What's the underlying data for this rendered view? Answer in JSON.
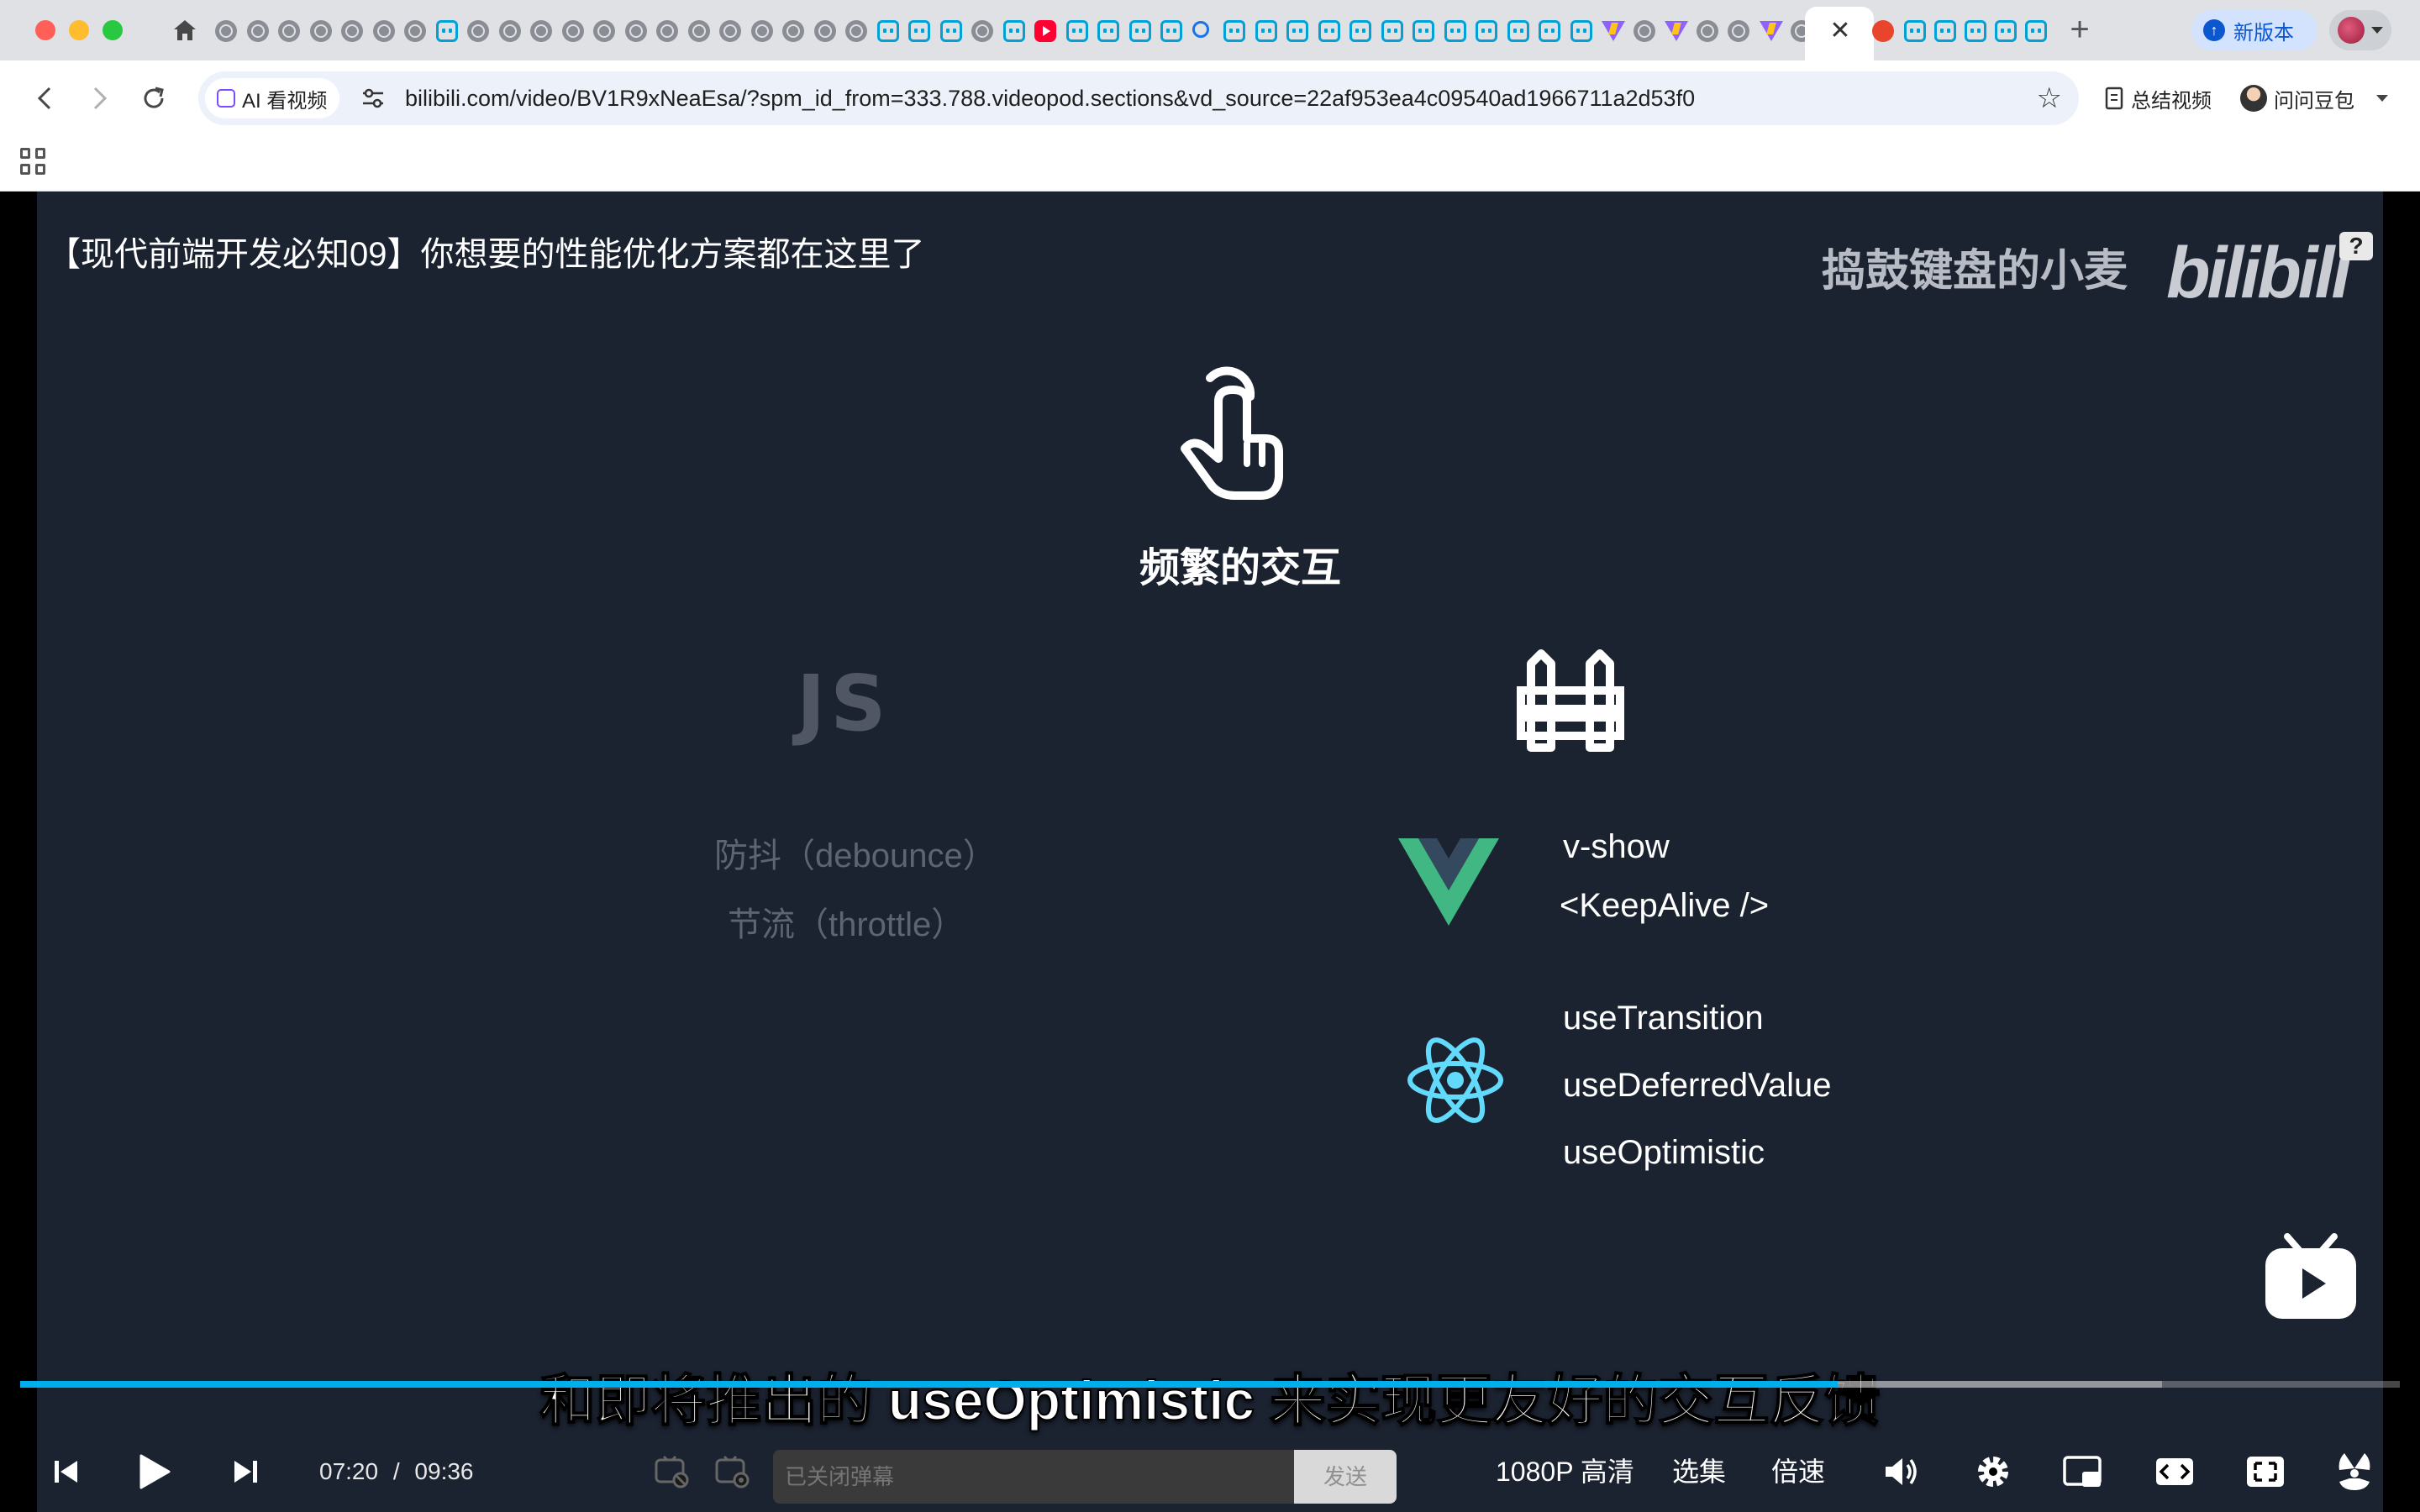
{
  "browser": {
    "new_tab_symbol": "+",
    "close_tab_symbol": "✕",
    "update_label": "新版本",
    "url": "bilibili.com/video/BV1R9xNeaEsa/?spm_id_from=333.788.videopod.sections&vd_source=22af953ea4c09540ad1966711a2d53f0",
    "ai_chip_label": "AI 看视频",
    "summary_label": "总结视频",
    "doubao_label": "问问豆包"
  },
  "video": {
    "title": "【现代前端开发必知09】你想要的性能优化方案都在这里了",
    "watermark": "捣鼓键盘的小麦",
    "logo_text": "bilibili",
    "help_badge": "?",
    "center_label": "频繁的交互",
    "js_logo_text": "JS",
    "js_items": [
      "防抖（debounce）",
      "节流（throttle）"
    ],
    "vue_items": [
      "v-show",
      "<KeepAlive />"
    ],
    "react_items": [
      "useTransition",
      "useDeferredValue",
      "useOptimistic"
    ],
    "subtitle": "和即将推出的 useOptimistic 来实现更友好的交互反馈"
  },
  "player": {
    "progress_fraction": 0.7639,
    "buffered_fraction": 0.9,
    "current_time": "07:20",
    "separator": "/",
    "duration": "09:36",
    "danmaku_placeholder": "已关闭弹幕",
    "send_label": "发送",
    "quality_label": "1080P 高清",
    "episodes_label": "选集",
    "speed_label": "倍速",
    "accent_color": "#00aeec"
  }
}
